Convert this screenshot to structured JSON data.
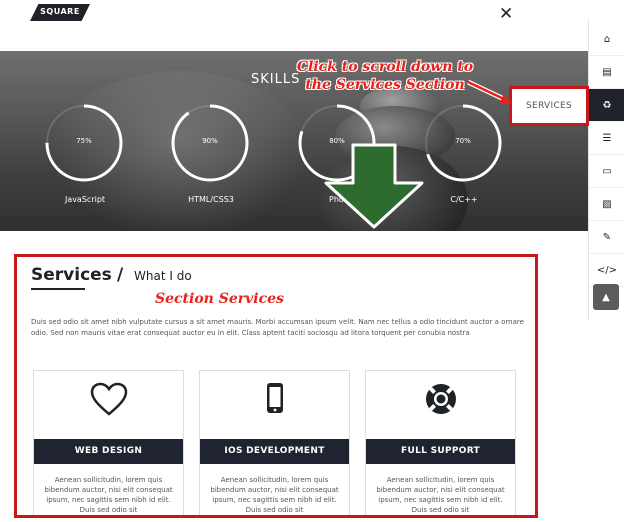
{
  "header": {
    "logo_text": "SQUARE",
    "close_symbol": "✕"
  },
  "hero": {
    "skills_title": "SKILLS",
    "skills": [
      {
        "name": "JavaScript",
        "value_label": "75%",
        "percent": 75
      },
      {
        "name": "HTML/CSS3",
        "value_label": "90%",
        "percent": 90
      },
      {
        "name": "Phot",
        "value_label": "80%",
        "percent": 80
      },
      {
        "name": "C/C++",
        "value_label": "70%",
        "percent": 70
      }
    ]
  },
  "annotation": {
    "callout_line1": "Click to scroll down to",
    "callout_line2": "the Services Section",
    "services_label": "SERVICES",
    "section_label": "Section Services",
    "accent_color": "#e8221a",
    "arrow_color": "#2e6b2e"
  },
  "sidebar": {
    "items": [
      {
        "icon": "home-icon",
        "glyph": "⌂"
      },
      {
        "icon": "book-icon",
        "glyph": "▤"
      },
      {
        "icon": "recycle-icon",
        "glyph": "♻",
        "active": true
      },
      {
        "icon": "list-icon",
        "glyph": "☰"
      },
      {
        "icon": "card-icon",
        "glyph": "▭"
      },
      {
        "icon": "image-icon",
        "glyph": "▨"
      },
      {
        "icon": "edit-icon",
        "glyph": "✎"
      },
      {
        "icon": "code-icon",
        "glyph": "</>"
      }
    ],
    "scroll_top_glyph": "▲"
  },
  "services": {
    "title": "Services",
    "slash": "/",
    "subtitle": "What I do",
    "description": "Duis sed odio sit amet nibh vulputate cursus a sit amet mauris. Morbi accumsan ipsum velit. Nam nec tellus a odio tincidunt auctor a ornare odio. Sed non mauris vitae erat consequat auctor eu in elit. Class aptent taciti sociosqu ad litora torquent per conubia nostra",
    "cards": [
      {
        "title": "WEB DESIGN",
        "icon": "heart-icon",
        "text": "Aenean sollicitudin, lorem quis bibendum auctor, nisi elit consequat ipsum, nec sagittis sem nibh id elit. Duis sed odio sit"
      },
      {
        "title": "IOS DEVELOPMENT",
        "icon": "phone-icon",
        "text": "Aenean sollicitudin, lorem quis bibendum auctor, nisi elit consequat ipsum, nec sagittis sem nibh id elit. Duis sed odio sit"
      },
      {
        "title": "FULL SUPPORT",
        "icon": "lifebuoy-icon",
        "text": "Aenean sollicitudin, lorem quis bibendum auctor, nisi elit consequat ipsum, nec sagittis sem nibh id elit. Duis sed odio sit"
      }
    ]
  }
}
